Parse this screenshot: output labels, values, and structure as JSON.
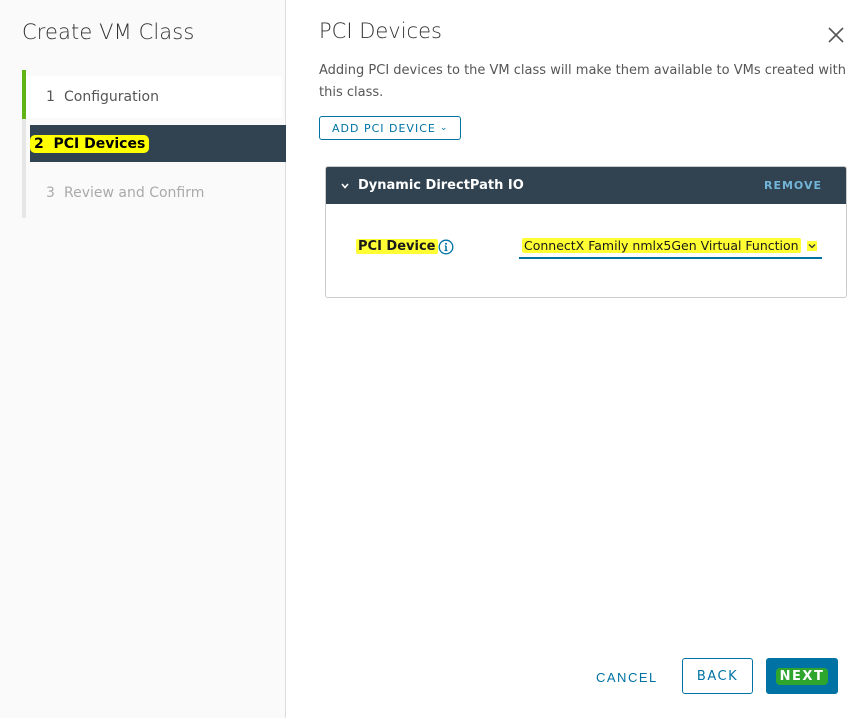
{
  "wizard": {
    "title": "Create VM Class",
    "steps": [
      {
        "number": "1",
        "label": "Configuration",
        "state": "done"
      },
      {
        "number": "2",
        "label": "PCI Devices",
        "state": "active"
      },
      {
        "number": "3",
        "label": "Review and Confirm",
        "state": "pending"
      }
    ]
  },
  "main": {
    "title": "PCI Devices",
    "description": "Adding PCI devices to the VM class will make them available to VMs created with this class.",
    "add_button": "ADD PCI DEVICE",
    "panel": {
      "title": "Dynamic DirectPath IO",
      "remove_label": "REMOVE",
      "field_label": "PCI Device",
      "selected_value": "ConnectX Family nmlx5Gen Virtual Function"
    }
  },
  "footer": {
    "cancel_label": "CANCEL",
    "back_label": "BACK",
    "next_label": "NEXT"
  },
  "colors": {
    "accent": "#0072a3",
    "header_dark": "#314351",
    "progress_green": "#60b515",
    "highlight_yellow": "#ffff33"
  },
  "icons": {
    "close": "close-icon",
    "info": "info-icon",
    "dropdown": "chevron-down-icon"
  }
}
